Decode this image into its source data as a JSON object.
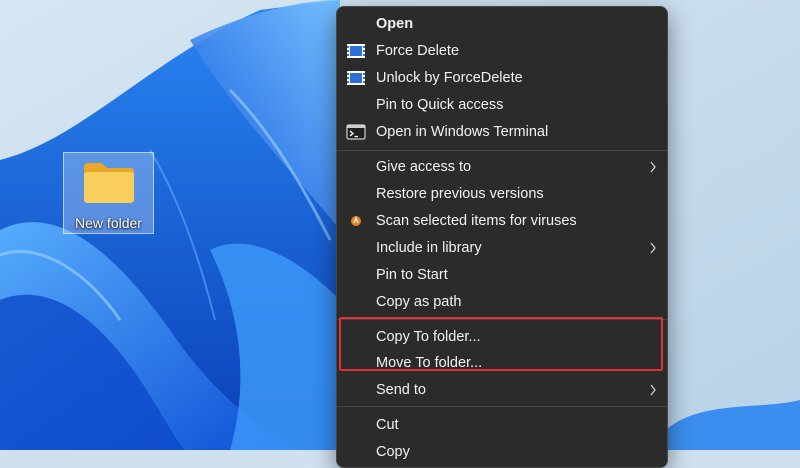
{
  "desktop": {
    "icon_label": "New folder"
  },
  "menu": {
    "items": [
      {
        "label": "Open",
        "icon": "none"
      },
      {
        "label": "Force Delete",
        "icon": "forcedelete-icon"
      },
      {
        "label": "Unlock by ForceDelete",
        "icon": "forcedelete-icon"
      },
      {
        "label": "Pin to Quick access",
        "icon": "none"
      },
      {
        "label": "Open in Windows Terminal",
        "icon": "terminal-icon"
      },
      {
        "label": "Give access to",
        "icon": "none",
        "submenu": true
      },
      {
        "label": "Restore previous versions",
        "icon": "none"
      },
      {
        "label": "Scan selected items for viruses",
        "icon": "antivirus-icon"
      },
      {
        "label": "Include in library",
        "icon": "none",
        "submenu": true
      },
      {
        "label": "Pin to Start",
        "icon": "none"
      },
      {
        "label": "Copy as path",
        "icon": "none"
      },
      {
        "label": "Copy To folder...",
        "icon": "none"
      },
      {
        "label": "Move To folder...",
        "icon": "none"
      },
      {
        "label": "Send to",
        "icon": "none",
        "submenu": true
      },
      {
        "label": "Cut",
        "icon": "none"
      },
      {
        "label": "Copy",
        "icon": "none"
      }
    ]
  },
  "colors": {
    "menu_background": "#2b2b2b",
    "highlight_border": "#e03232",
    "wallpaper_blue": "#1f6fe0"
  }
}
